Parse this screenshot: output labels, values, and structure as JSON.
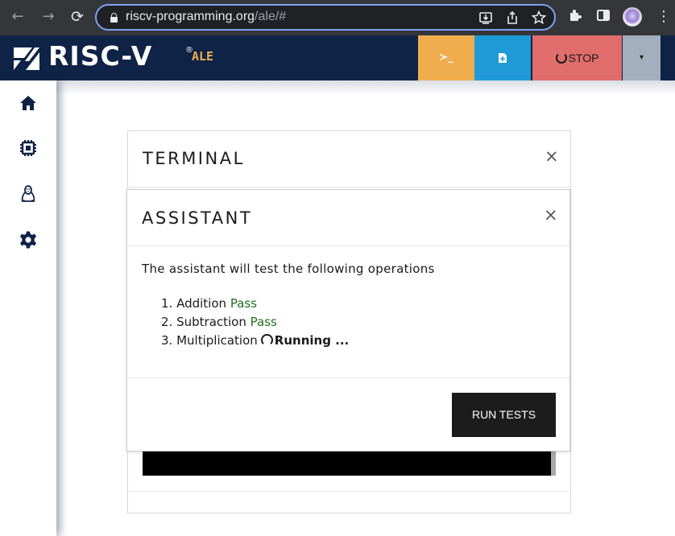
{
  "browser": {
    "url_host": "riscv-programming.org",
    "url_path": "/ale/#",
    "back_glyph": "←",
    "forward_glyph": "→",
    "reload_glyph": "⟳",
    "menu_glyph": "⋮"
  },
  "header": {
    "logo_text": "RISC-V",
    "logo_reg": "®",
    "logo_suffix": "ALE",
    "terminal_glyph": "≻_",
    "file_glyph": "▮",
    "stop_label": "STOP",
    "dropdown_glyph": "▾",
    "colors": {
      "navy": "#0e2345",
      "terminal": "#f0ad4e",
      "file": "#1f9ad6",
      "stop": "#e06d6b",
      "dropdown": "#a3aebe"
    }
  },
  "sidebar": {
    "items": [
      {
        "icon": "home-icon"
      },
      {
        "icon": "chip-icon"
      },
      {
        "icon": "linux-penguin-icon"
      },
      {
        "icon": "gear-icon"
      }
    ]
  },
  "terminal": {
    "title": "TERMINAL",
    "close": "×"
  },
  "assistant": {
    "title": "ASSISTANT",
    "close": "×",
    "intro": "The assistant will test the following operations",
    "operations": [
      {
        "number": "1.",
        "name": "Addition",
        "status": "Pass"
      },
      {
        "number": "2.",
        "name": "Subtraction",
        "status": "Pass"
      },
      {
        "number": "3.",
        "name": "Multiplication",
        "status": "Running ..."
      }
    ],
    "run_button": "RUN TESTS",
    "pass_color": "#1f6e1f"
  }
}
